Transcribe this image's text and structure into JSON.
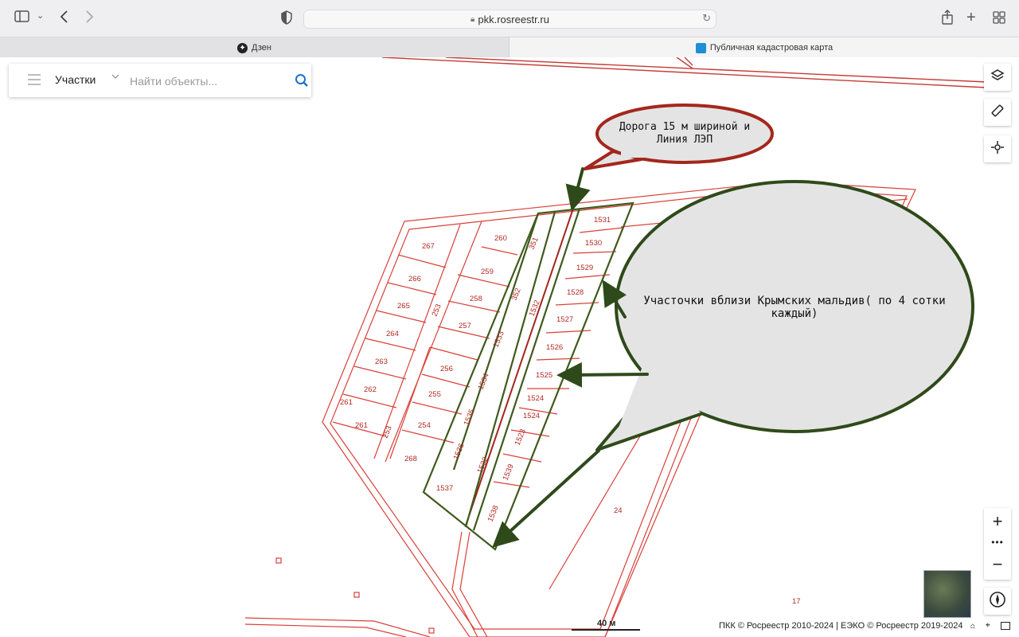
{
  "browser": {
    "url": "pkk.rosreestr.ru",
    "tabs": [
      {
        "label": "Дзен"
      },
      {
        "label": "Публичная кадастровая карта"
      }
    ]
  },
  "search": {
    "category": "Участки",
    "placeholder": "Найти объекты..."
  },
  "map": {
    "parcel_labels": [
      "267",
      "266",
      "265",
      "264",
      "263",
      "262",
      "261",
      "261",
      "253",
      "253",
      "260",
      "259",
      "258",
      "257",
      "256",
      "255",
      "254",
      "268",
      "351",
      "352",
      "1532",
      "1533",
      "1534",
      "1535",
      "1536",
      "1532",
      "1537",
      "1538",
      "1531",
      "1530",
      "1529",
      "1528",
      "1527",
      "1526",
      "1525",
      "1524",
      "1524",
      "1523",
      "1539",
      "24",
      "17"
    ],
    "callout_road": "Дорога 15 м шириной и Линия ЛЭП",
    "callout_plots": "Участочки вблизи Крымских мальдив( по 4 сотки каждый)",
    "scale_label": "40 м",
    "copyright": "ПКК © Росреестр 2010-2024 | ЕЭКО © Росреестр 2019-2024",
    "colors": {
      "parcel": "#d9403a",
      "highlight": "#3f5a1d",
      "callout_red": "#a3271d",
      "callout_green": "#2f4a1a",
      "bubble": "#e4e4e4"
    }
  }
}
